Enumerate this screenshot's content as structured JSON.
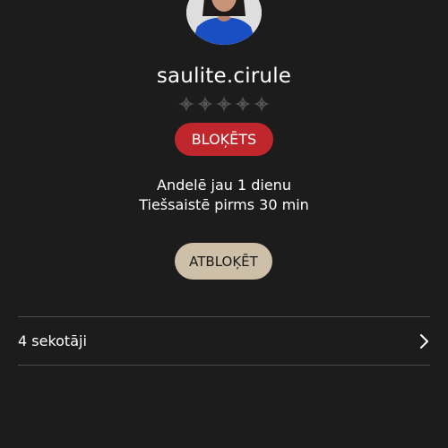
{
  "profile": {
    "username": "saulite.cirule",
    "rating_stars": 5,
    "rating_filled": 0,
    "status_badge": "BLOĶĒTS",
    "member_since": "Andelē jau 1 dienu",
    "last_online": "Tiešsaistē pirms 30 min"
  },
  "actions": {
    "unblock_label": "ATBLOĶĒT"
  },
  "followers": {
    "label": "4 sekotāji"
  },
  "colors": {
    "background": "#1c1c1c",
    "blocked_badge": "#c0272d",
    "unblock_button": "#cdbfa8",
    "star_empty": "#555555",
    "divider": "#4a4a4a"
  },
  "icons": {
    "rating": "star-icon",
    "followers_chevron": "chevron-right-icon"
  }
}
